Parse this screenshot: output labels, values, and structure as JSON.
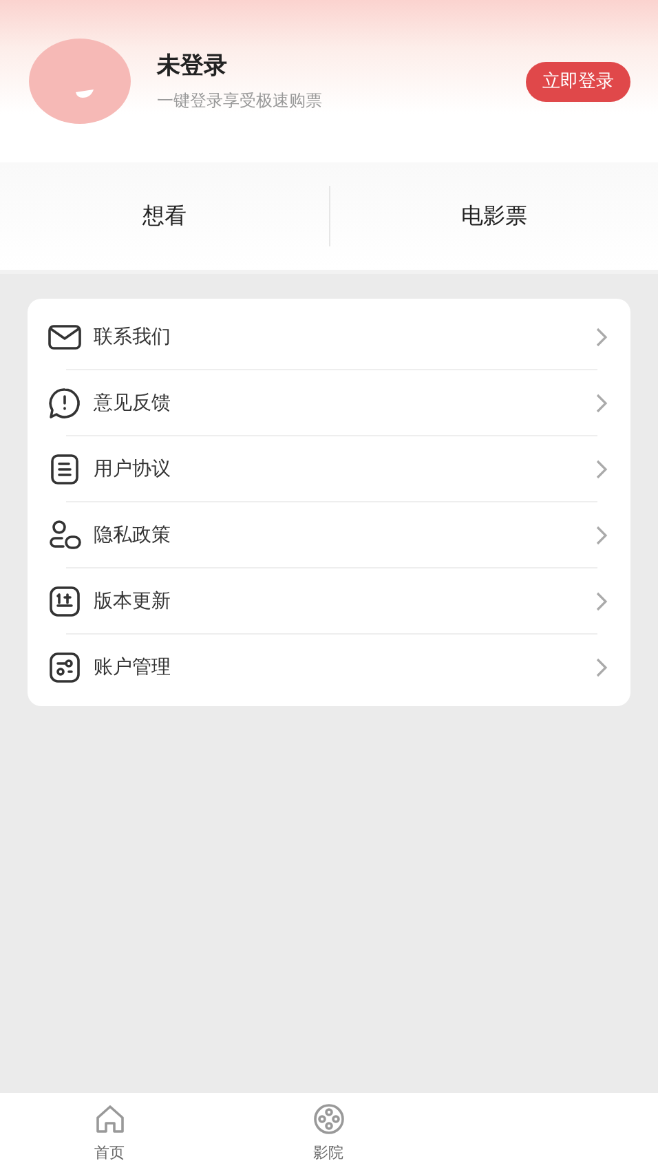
{
  "profile": {
    "name": "未登录",
    "subtitle": "一键登录享受极速购票",
    "login_button": "立即登录"
  },
  "quick_tabs": [
    {
      "label": "想看"
    },
    {
      "label": "电影票"
    }
  ],
  "menu": [
    {
      "label": "联系我们"
    },
    {
      "label": "意见反馈"
    },
    {
      "label": "用户协议"
    },
    {
      "label": "隐私政策"
    },
    {
      "label": "版本更新"
    },
    {
      "label": "账户管理"
    }
  ],
  "bottom_nav": [
    {
      "label": "首页"
    },
    {
      "label": "影院"
    }
  ]
}
